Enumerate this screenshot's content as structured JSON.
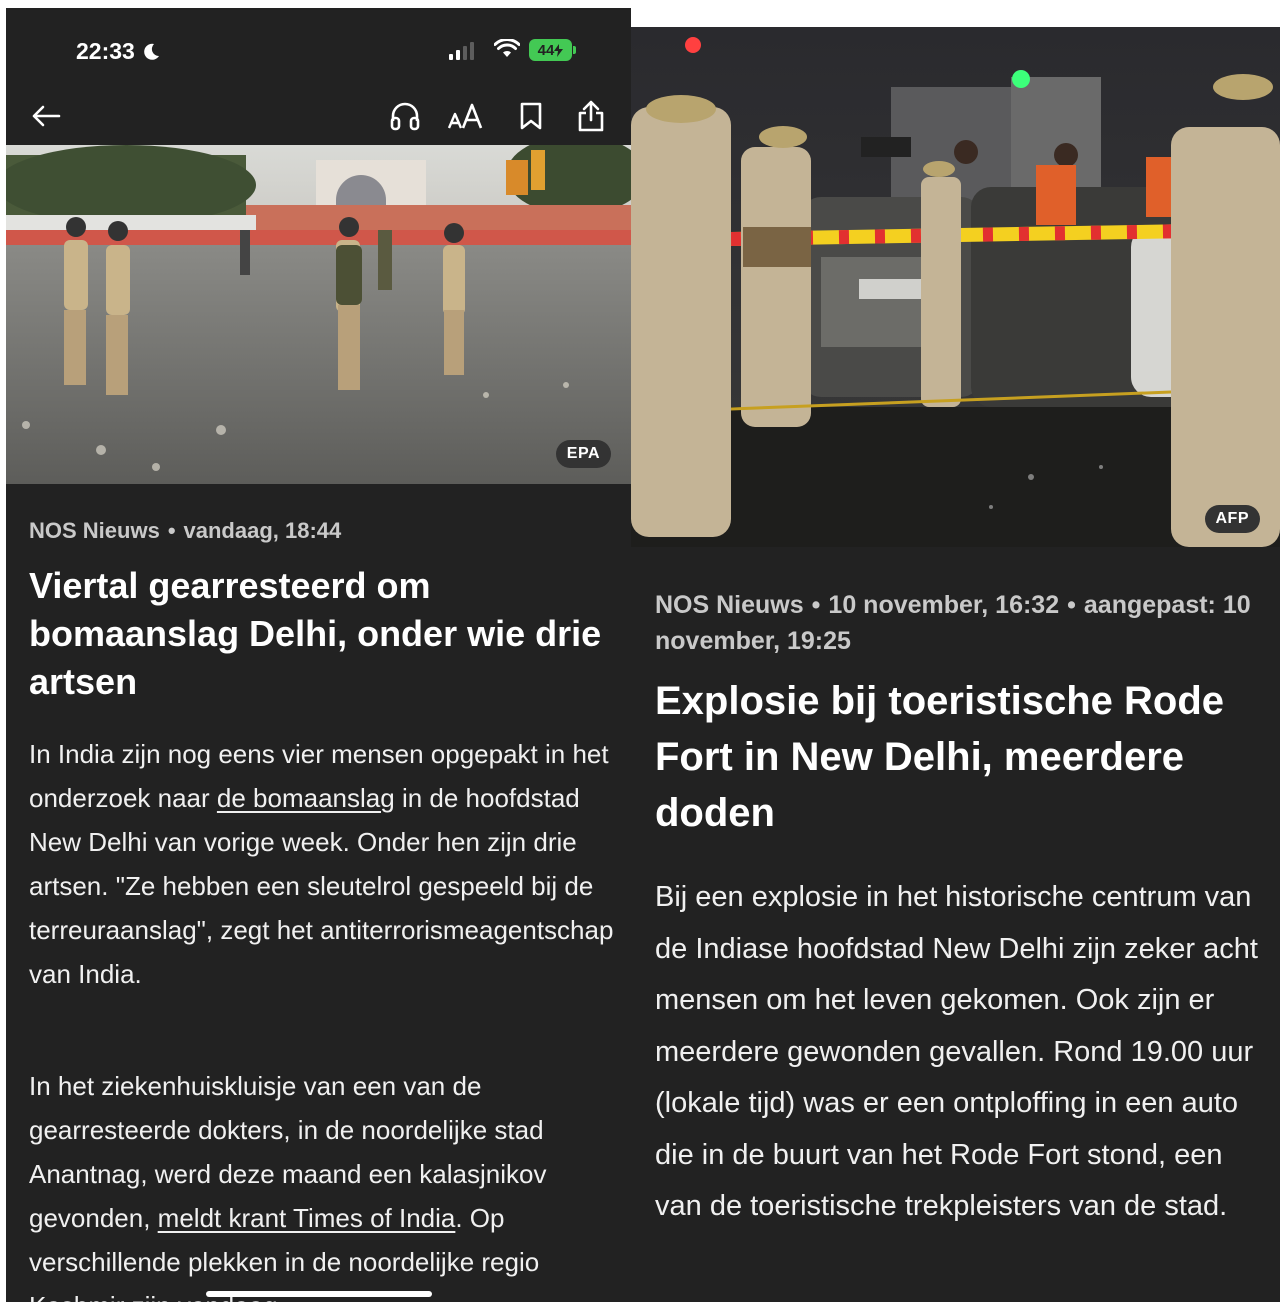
{
  "left": {
    "status": {
      "time": "22:33",
      "battery": "44"
    },
    "photo_credit": "EPA",
    "source": "NOS Nieuws",
    "separator": "•",
    "timestamp": "vandaag, 18:44",
    "headline": "Viertal gearresteerd om bomaanslag Delhi, onder wie drie artsen",
    "paragraph1": {
      "part1": "In India zijn nog eens vier mensen opgepakt in het onderzoek naar ",
      "link": "de bomaanslag",
      "part2": " in de hoofdstad New Delhi van vorige week. Onder hen zijn drie artsen. \"Ze hebben een sleutelrol gespeeld bij de terreuraanslag\", zegt het antiterrorismeagentschap van India."
    },
    "paragraph2": {
      "part1": "In het ziekenhuiskluisje van een van de gearresteerde dokters, in de noordelijke stad Anantnag, werd deze maand een kalasjnikov gevonden, ",
      "link": "meldt krant Times of India",
      "part2": ". Op verschillende plekken in de noordelijke regio Kashmir zijn vandaag"
    }
  },
  "right": {
    "photo_credit": "AFP",
    "source": "NOS Nieuws",
    "separator": "•",
    "timestamp": "10 november, 16:32",
    "updated": "aangepast: 10 november, 19:25",
    "headline": "Explosie bij toeristische Rode Fort in New Delhi, meerdere doden",
    "paragraph1": "Bij een explosie in het historische centrum van de Indiase hoofdstad New Delhi zijn zeker acht mensen om het leven gekomen. Ook zijn er meerdere gewonden gevallen. Rond 19.00 uur (lokale tijd) was er een ontploffing in een auto die in de buurt van het Rode Fort stond, een van de toeristische trekpleisters van de stad."
  },
  "icons": {
    "back": "arrow-left-icon",
    "listen": "headphones-icon",
    "text_size": "text-size-icon",
    "bookmark": "bookmark-icon",
    "share": "share-icon"
  },
  "colors": {
    "background": "#222222",
    "battery": "#43c954",
    "text": "#f0f0f0",
    "meta": "#c9c9c9"
  }
}
